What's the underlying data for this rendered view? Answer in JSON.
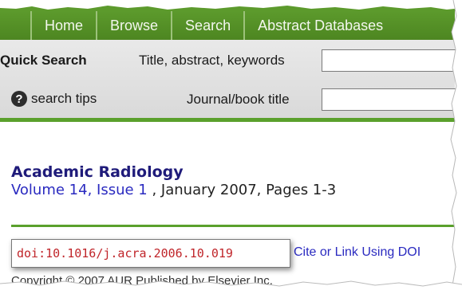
{
  "nav": {
    "items": [
      {
        "label": "Home"
      },
      {
        "label": "Browse"
      },
      {
        "label": "Search"
      },
      {
        "label": "Abstract Databases"
      }
    ]
  },
  "quick_search": {
    "label": "Quick Search",
    "field1_label": "Title, abstract, keywords",
    "field1_value": "",
    "field2_label": "Journal/book title",
    "field2_value": "",
    "tips_label": "search tips",
    "help_icon": "question-circle-icon"
  },
  "article": {
    "journal_title": "Academic Radiology",
    "volume_issue": "Volume 14, Issue 1",
    "date_pages": " , January 2007, Pages 1-3",
    "doi": "doi:10.1016/j.acra.2006.10.019",
    "cite_link": "Cite or Link Using DOI",
    "copyright": "Copyright © 2007 AUR Published by Elsevier Inc."
  },
  "colors": {
    "nav_green": "#5c9a2c",
    "link_blue": "#2a2ac0",
    "title_navy": "#1f1b7a",
    "doi_red": "#c0252a"
  }
}
